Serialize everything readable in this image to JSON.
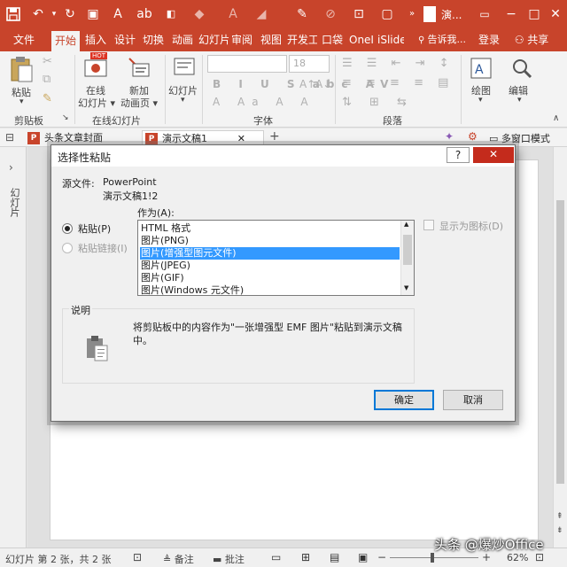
{
  "titlebar": {
    "title": "演..."
  },
  "tabs": [
    "文件",
    "开始",
    "插入",
    "设计",
    "切换",
    "动画",
    "幻灯片",
    "审阅",
    "视图",
    "开发工",
    "口袋",
    "OneI",
    "iSlide",
    "告诉我...",
    "登录",
    "共享"
  ],
  "ribbon": {
    "paste_label": "粘贴",
    "clipboard_group": "剪贴板",
    "online_slides_label1": "在线",
    "online_slides_label2": "幻灯片",
    "new_anim_label1": "新加",
    "new_anim_label2": "动画页",
    "online_group": "在线幻灯片",
    "slides_label": "幻灯片",
    "font_size": "18",
    "font_group": "字体",
    "paragraph_group": "段落",
    "drawing_label": "绘图",
    "editing_label": "编辑",
    "hot_badge": "HOT"
  },
  "doctabs": {
    "tab1": "头条文章封面",
    "tab2": "演示文稿1",
    "multiwindow": "多窗口模式"
  },
  "leftpane": {
    "label": "幻灯片"
  },
  "statusbar": {
    "slide_info": "幻灯片 第 2 张，共 2 张",
    "notes": "备注",
    "comments": "批注",
    "zoom": "62%",
    "watermark": "头条 @爆炒Office"
  },
  "dialog": {
    "title": "选择性粘贴",
    "help": "?",
    "close": "✕",
    "source_label": "源文件:",
    "source_app": "PowerPoint",
    "source_doc": "演示文稿1!2",
    "as_label": "作为(A):",
    "radio_paste": "粘贴(P)",
    "radio_link": "粘贴链接(I)",
    "formats": [
      "HTML 格式",
      "图片(PNG)",
      "图片(增强型图元文件)",
      "图片(JPEG)",
      "图片(GIF)",
      "图片(Windows 元文件)"
    ],
    "selected_index": 2,
    "show_icon": "显示为图标(D)",
    "description_title": "说明",
    "description_text": "将剪贴板中的内容作为\"一张增强型 EMF 图片\"粘贴到演示文稿中。",
    "ok": "确定",
    "cancel": "取消"
  },
  "colors": {
    "accent": "#c8442b",
    "selection": "#3399ff"
  }
}
